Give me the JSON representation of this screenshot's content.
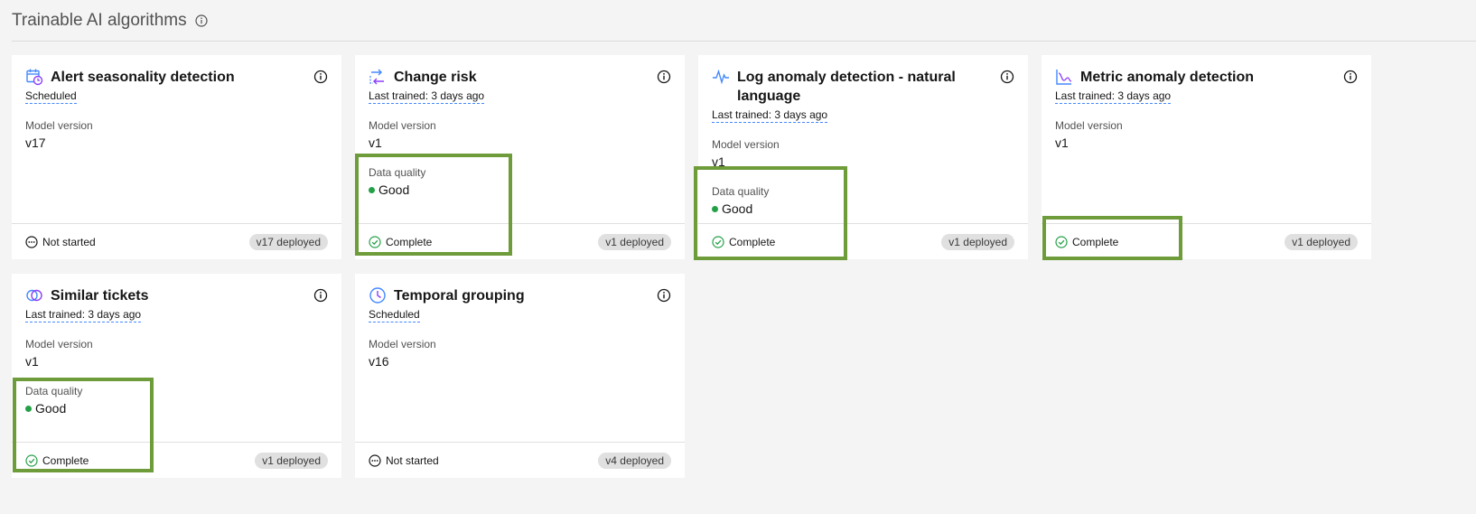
{
  "header": {
    "title": "Trainable AI algorithms"
  },
  "labels": {
    "model_version": "Model version",
    "data_quality": "Data quality"
  },
  "cards": [
    {
      "name": "Alert seasonality detection",
      "status": "Scheduled",
      "model_version": "v17",
      "data_quality": "",
      "state": "Not started",
      "deployed": "v17 deployed"
    },
    {
      "name": "Change risk",
      "status": "Last trained: 3 days ago",
      "model_version": "v1",
      "data_quality": "Good",
      "state": "Complete",
      "deployed": "v1 deployed"
    },
    {
      "name": "Log anomaly detection - natural language",
      "status": "Last trained: 3 days ago",
      "model_version": "v1",
      "data_quality": "Good",
      "state": "Complete",
      "deployed": "v1 deployed"
    },
    {
      "name": "Metric anomaly detection",
      "status": "Last trained: 3 days ago",
      "model_version": "v1",
      "data_quality": "",
      "state": "Complete",
      "deployed": "v1 deployed"
    },
    {
      "name": "Similar tickets",
      "status": "Last trained: 3 days ago",
      "model_version": "v1",
      "data_quality": "Good",
      "state": "Complete",
      "deployed": "v1 deployed"
    },
    {
      "name": "Temporal grouping",
      "status": "Scheduled",
      "model_version": "v16",
      "data_quality": "",
      "state": "Not started",
      "deployed": "v4 deployed"
    }
  ],
  "colors": {
    "accent": "#4589ff",
    "good": "#24a148",
    "highlight": "#6e9c3a"
  }
}
